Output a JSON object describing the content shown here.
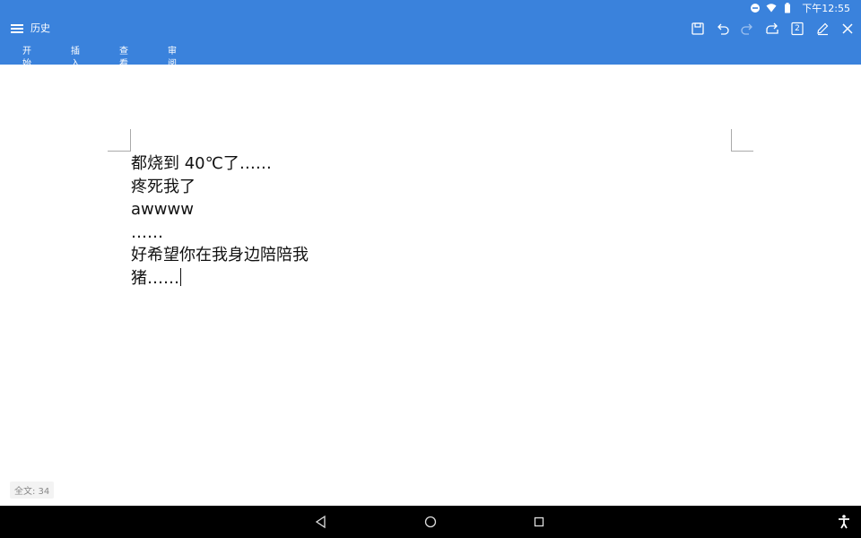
{
  "status_bar": {
    "time": "下午12:55",
    "icons": [
      "do-not-disturb-icon",
      "wifi-icon",
      "battery-icon"
    ]
  },
  "app_bar": {
    "title": "历史",
    "tabs": [
      {
        "label": "开始"
      },
      {
        "label": "插入"
      },
      {
        "label": "查看"
      },
      {
        "label": "审阅"
      }
    ],
    "tools": [
      "save-icon",
      "undo-icon",
      "redo-icon",
      "share-icon",
      "page-count-icon",
      "edit-icon",
      "close-icon"
    ],
    "page_badge": "2"
  },
  "document": {
    "lines": [
      "都烧到 40℃了……",
      "疼死我了",
      "awwww",
      "……",
      "好希望你在我身边陪陪我",
      "猪……"
    ]
  },
  "word_count": "全文: 34",
  "nav_bar": {
    "buttons": [
      "back-icon",
      "home-icon",
      "recents-icon",
      "accessibility-icon"
    ]
  },
  "colors": {
    "accent": "#3a82dc",
    "nav_background": "#000000"
  }
}
